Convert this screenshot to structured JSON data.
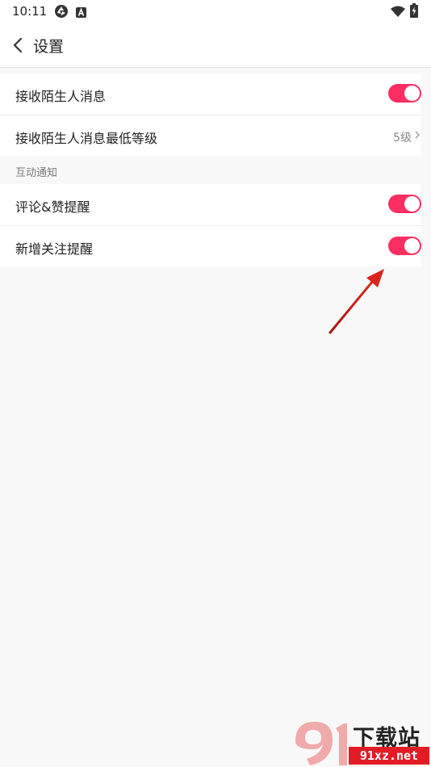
{
  "status_bar": {
    "time": "10:11",
    "left_icons": [
      "aperture-icon",
      "a-badge-icon"
    ],
    "right_icons": [
      "wifi-icon",
      "battery-charging-icon"
    ]
  },
  "app_bar": {
    "back_icon": "chevron-left-icon",
    "title": "设置"
  },
  "sections": [
    {
      "header": "",
      "rows": [
        {
          "label": "接收陌生人消息",
          "control": "toggle",
          "on": true
        },
        {
          "label": "接收陌生人消息最低等级",
          "control": "value",
          "value": "5级"
        }
      ]
    },
    {
      "header": "互动通知",
      "rows": [
        {
          "label": "评论&赞提醒",
          "control": "toggle",
          "on": true
        },
        {
          "label": "新增关注提醒",
          "control": "toggle",
          "on": true
        }
      ]
    }
  ],
  "annotation": {
    "type": "arrow-icon",
    "color": "#d9241c"
  },
  "watermark": {
    "brand_text": "下载站",
    "url_text": "91xz.net",
    "logo": "91-logo-icon"
  },
  "colors": {
    "toggle_on": "#fd2e62",
    "background": "#f8f8f8",
    "card": "#ffffff",
    "watermark_red": "#e21c24"
  }
}
